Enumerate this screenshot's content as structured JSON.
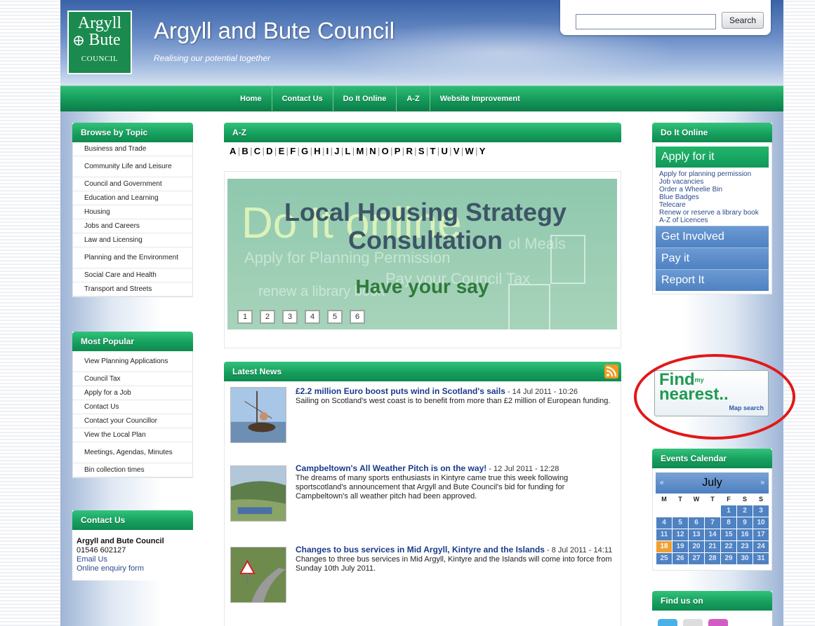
{
  "header": {
    "logo_line1": "Argyll",
    "logo_line2": "Bute",
    "logo_line3": "COUNCIL",
    "site_title": "Argyll and Bute Council",
    "tagline": "Realising our potential together",
    "search_placeholder": "",
    "search_button": "Search"
  },
  "nav": {
    "items": [
      "Home",
      "Contact Us",
      "Do It Online",
      "A-Z",
      "Website Improvement"
    ]
  },
  "browse": {
    "title": "Browse by Topic",
    "items": [
      "Business and Trade",
      "Community Life and Leisure",
      "Council and Government",
      "Education and Learning",
      "Housing",
      "Jobs and Careers",
      "Law and Licensing",
      "Planning and the Environment",
      "Social Care and Health",
      "Transport and Streets"
    ]
  },
  "popular": {
    "title": "Most Popular",
    "items": [
      "View Planning Applications",
      "Council Tax",
      "Apply for a Job",
      "Contact Us",
      "Contact your Councillor",
      "View the Local Plan",
      "Meetings, Agendas, Minutes",
      "Bin collection times"
    ]
  },
  "contact": {
    "title": "Contact Us",
    "org": "Argyll and Bute Council",
    "phone": "01546 602127",
    "email": "Email Us",
    "enquiry": "Online enquiry form"
  },
  "az": {
    "title": "A-Z",
    "letters": [
      "A",
      "B",
      "C",
      "D",
      "E",
      "F",
      "G",
      "H",
      "I",
      "J",
      "L",
      "M",
      "N",
      "O",
      "P",
      "R",
      "S",
      "T",
      "U",
      "V",
      "W",
      "Y"
    ]
  },
  "banner": {
    "ghost1": "Do It online",
    "ghost2": "Apply for Planning Permission",
    "ghost3": "Pay your Council Tax",
    "ghost4": "ol Meals",
    "ghost5": "renew a library book",
    "line1": "Local Housing Strategy",
    "line2": "Consultation",
    "line3": "Have your say",
    "pages": [
      "1",
      "2",
      "3",
      "4",
      "5",
      "6"
    ]
  },
  "news": {
    "title": "Latest News",
    "items": [
      {
        "title": "£2.2 million Euro boost puts wind in Scotland's sails",
        "date": " - 14 Jul 2011 - 10:26",
        "summary": "Sailing on Scotland's west coast is to benefit from more than £2 million of European funding."
      },
      {
        "title": "Campbeltown's All Weather Pitch is on the way!",
        "date": " - 12 Jul 2011 - 12:28",
        "summary": "The dreams of many sports enthusiasts in Kintyre came true this week following sportscotland's announcement that Argyll and Bute Council's bid for funding for Campbeltown's all weather pitch had been approved."
      },
      {
        "title": "Changes to bus services in Mid Argyll, Kintyre and the Islands",
        "date": " - 8 Jul 2011 - 14:11",
        "summary": "Changes to three bus services in Mid Argyll, Kintyre and the Islands will come into force from Sunday 10th July 2011."
      }
    ]
  },
  "doit": {
    "title": "Do It Online",
    "apply": "Apply for it",
    "links": [
      "Apply for planning permission",
      "Job vacancies",
      "Order a Wheelie Bin",
      "Blue Badges",
      "Telecare",
      "Renew or reserve a library book",
      "A-Z of Licences"
    ],
    "get_involved": "Get Involved",
    "pay": "Pay it",
    "report": "Report It"
  },
  "findnearest": {
    "line1": "Find",
    "my": "my",
    "line2": "nearest..",
    "sub": "Map search"
  },
  "calendar": {
    "title": "Events Calendar",
    "month": "July",
    "prev": "«",
    "next": "»",
    "dow": [
      "M",
      "T",
      "W",
      "T",
      "F",
      "S",
      "S"
    ],
    "days": [
      "",
      "",
      "",
      "",
      "1",
      "2",
      "3",
      "4",
      "5",
      "6",
      "7",
      "8",
      "9",
      "10",
      "11",
      "12",
      "13",
      "14",
      "15",
      "16",
      "17",
      "18",
      "19",
      "20",
      "21",
      "22",
      "23",
      "24",
      "25",
      "26",
      "27",
      "28",
      "29",
      "30",
      "31"
    ],
    "today": "18"
  },
  "findus": {
    "title": "Find us on"
  },
  "colors": {
    "green": "#16a05e",
    "blue": "#4f82c2",
    "highlight": "#e21818"
  }
}
